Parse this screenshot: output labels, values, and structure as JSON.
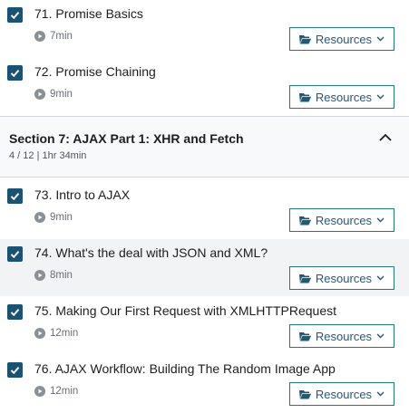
{
  "lessons_top": [
    {
      "title": "71. Promise Basics",
      "duration": "7min",
      "resources_label": "Resources"
    },
    {
      "title": "72. Promise Chaining",
      "duration": "9min",
      "resources_label": "Resources"
    }
  ],
  "section": {
    "title": "Section 7: AJAX Part 1: XHR and Fetch",
    "meta": "4 / 12 | 1hr 34min"
  },
  "lessons_bottom": [
    {
      "title": "73. Intro to AJAX",
      "duration": "9min",
      "resources_label": "Resources"
    },
    {
      "title": "74. What's the deal with JSON and XML?",
      "duration": "8min",
      "resources_label": "Resources"
    },
    {
      "title": "75. Making Our First Request with XMLHTTPRequest",
      "duration": "12min",
      "resources_label": "Resources"
    },
    {
      "title": "76. AJAX Workflow: Building The Random Image App",
      "duration": "12min",
      "resources_label": "Resources"
    }
  ],
  "colors": {
    "check": "#1a5276",
    "accent": "#1f7a7a",
    "highlight_row": "#f2f3f5"
  },
  "icons": {
    "check": "check-icon",
    "play": "play-circle-icon",
    "folder": "folder-open-icon",
    "chevron": "chevron-down-icon",
    "collapse": "chevron-up-icon"
  }
}
